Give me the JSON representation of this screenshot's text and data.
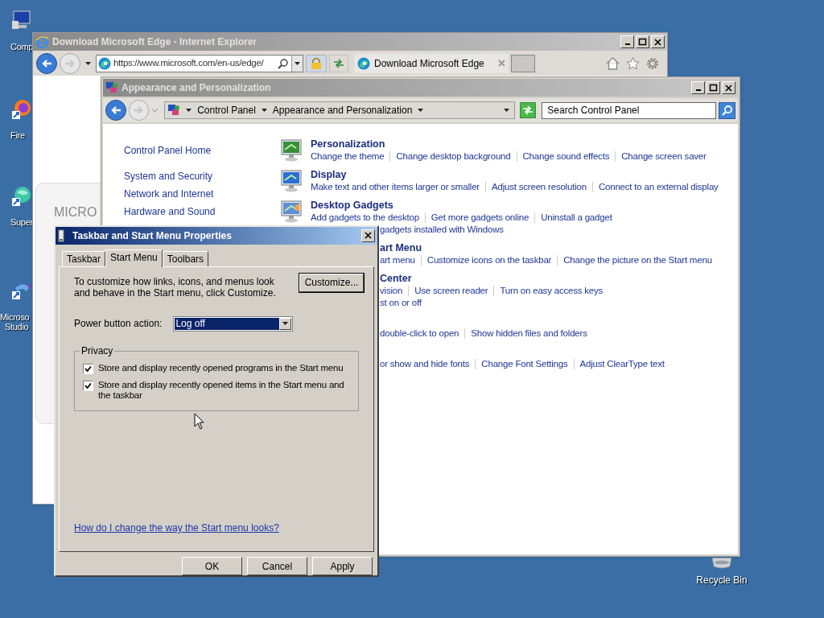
{
  "desktop": {
    "icons": [
      {
        "kind": "computer",
        "label": [
          "Comp"
        ]
      },
      {
        "kind": "firefox",
        "label": [
          "Fire"
        ]
      },
      {
        "kind": "app",
        "label": [
          "Super"
        ]
      },
      {
        "kind": "studio",
        "label": [
          "Microso",
          "Studio"
        ]
      }
    ],
    "recycle_bin": {
      "label": "Recycle Bin"
    }
  },
  "browser": {
    "title": "Download Microsoft Edge - Internet Explorer",
    "address": "https://www.microsoft.com/en-us/edge/",
    "tab_title": "Download Microsoft Edge",
    "page_text": "MICRO"
  },
  "control_panel": {
    "title": "Appearance and Personalization",
    "breadcrumb": [
      "Control Panel",
      "Appearance and Personalization"
    ],
    "search_placeholder": "Search Control Panel",
    "nav": [
      {
        "label": "Control Panel Home"
      },
      {
        "label": "System and Security"
      },
      {
        "label": "Network and Internet"
      },
      {
        "label": "Hardware and Sound"
      }
    ],
    "categories": [
      {
        "kind": "personalization",
        "title": "Personalization",
        "lines": [
          {
            "links": [
              "Change the theme",
              "Change desktop background",
              "Change sound effects",
              "Change screen saver"
            ]
          }
        ]
      },
      {
        "kind": "display",
        "title": "Display",
        "lines": [
          {
            "links": [
              "Make text and other items larger or smaller",
              "Adjust screen resolution",
              "Connect to an external display"
            ]
          }
        ]
      },
      {
        "kind": "gadgets",
        "title": "Desktop Gadgets",
        "lines": [
          {
            "links": [
              "Add gadgets to the desktop",
              "Get more gadgets online",
              "Uninstall a gadget"
            ]
          },
          {
            "partly_hidden": true,
            "links": [
              "gadgets installed with Windows"
            ]
          }
        ]
      },
      {
        "title": "art Menu",
        "title_partly_hidden": true,
        "lines": [
          {
            "partly_hidden": true,
            "links": [
              "art menu",
              "Customize icons on the taskbar",
              "Change the picture on the Start menu"
            ]
          }
        ]
      },
      {
        "title": "Center",
        "title_partly_hidden": true,
        "lines": [
          {
            "partly_hidden": true,
            "links": [
              "vision",
              "Use screen reader",
              "Turn on easy access keys"
            ]
          },
          {
            "partly_hidden": true,
            "links": [
              "st on or off"
            ]
          }
        ]
      },
      {
        "lines": [
          {
            "partly_hidden": true,
            "links": [
              "double-click to open",
              "Show hidden files and folders"
            ]
          }
        ]
      },
      {
        "lines": [
          {
            "partly_hidden": true,
            "links": [
              "or show and hide fonts",
              "Change Font Settings",
              "Adjust ClearType text"
            ]
          }
        ]
      }
    ]
  },
  "dialog": {
    "title": "Taskbar and Start Menu Properties",
    "tabs": [
      {
        "label": "Taskbar",
        "selected": false
      },
      {
        "label": "Start Menu",
        "selected": true
      },
      {
        "label": "Toolbars",
        "selected": false
      }
    ],
    "description": "To customize how links, icons, and menus look and behave in the Start menu, click Customize.",
    "customize_button": "Customize...",
    "power_label": "Power button action:",
    "power_value": "Log off",
    "privacy": {
      "title": "Privacy",
      "options": [
        {
          "label": "Store and display recently opened programs in the Start menu",
          "checked": true
        },
        {
          "label": "Store and display recently opened items in the Start menu and the taskbar",
          "checked": true
        }
      ]
    },
    "help_link": "How do I change the way the Start menu looks?",
    "buttons": [
      "OK",
      "Cancel",
      "Apply"
    ]
  }
}
